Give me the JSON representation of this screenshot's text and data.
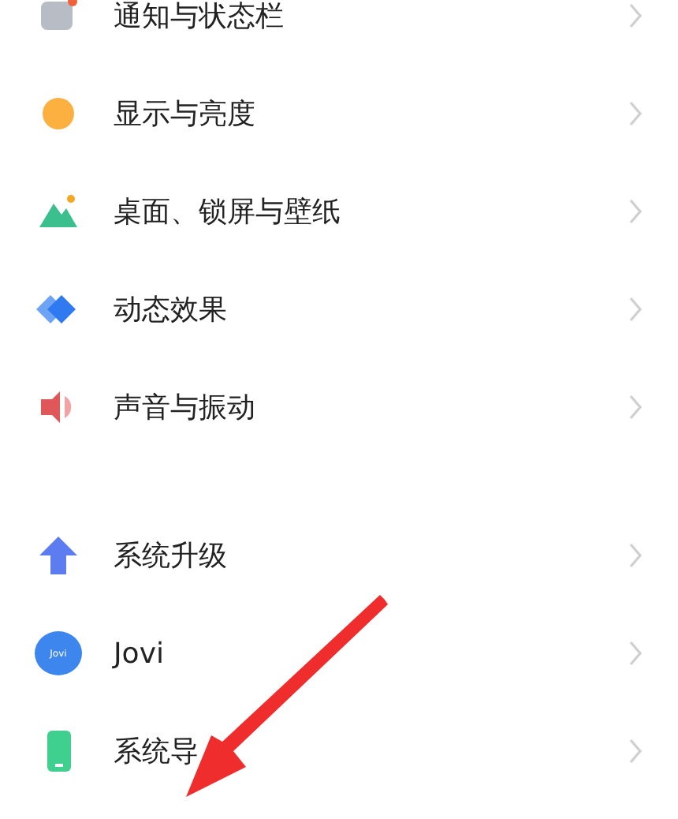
{
  "groups": [
    {
      "items": [
        {
          "kind": "notification",
          "label": "通知与状态栏"
        },
        {
          "kind": "display",
          "label": "显示与亮度"
        },
        {
          "kind": "wallpaper",
          "label": "桌面、锁屏与壁纸"
        },
        {
          "kind": "motion",
          "label": "动态效果"
        },
        {
          "kind": "sound",
          "label": "声音与振动"
        }
      ]
    },
    {
      "items": [
        {
          "kind": "upgrade",
          "label": "系统升级"
        },
        {
          "kind": "jovi",
          "label": "Jovi",
          "icon_text": "Jovi"
        },
        {
          "kind": "navigation",
          "label": "系统导"
        }
      ]
    }
  ]
}
